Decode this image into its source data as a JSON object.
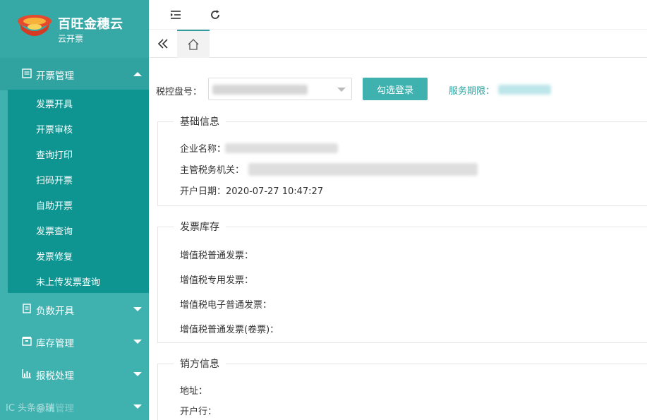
{
  "brand": {
    "title": "百旺金穗云",
    "subtitle": "云开票"
  },
  "sidebar": {
    "groups": [
      {
        "label": "开票管理",
        "icon": "invoice-icon",
        "expanded": true
      },
      {
        "label": "负数开具",
        "icon": "document-icon",
        "expanded": false
      },
      {
        "label": "库存管理",
        "icon": "inventory-icon",
        "expanded": false
      },
      {
        "label": "报税处理",
        "icon": "bar-chart-icon",
        "expanded": false
      },
      {
        "label": "系统管理",
        "icon": "settings-icon",
        "expanded": false
      }
    ],
    "submenu": [
      "发票开具",
      "开票审核",
      "查询打印",
      "扫码开票",
      "自助开票",
      "发票查询",
      "发票修复",
      "未上传发票查询"
    ],
    "watermark": "IC 头条@瑞"
  },
  "toolbar": {
    "menu_icon": "menu-fold-icon",
    "refresh_icon": "refresh-icon"
  },
  "tabs": {
    "collapse_icon": "double-chevron-left-icon",
    "home_icon": "home-icon"
  },
  "main": {
    "disk_label": "税控盘号：",
    "login_button": "勾选登录",
    "service_label": "服务期限：",
    "basic": {
      "legend": "基础信息",
      "company_label": "企业名称：",
      "tax_office_label": "主管税务机关：",
      "open_date_label": "开户日期：",
      "open_date_value": "2020-07-27 10:47:27"
    },
    "stock": {
      "legend": "发票库存",
      "rows": [
        "增值税普通发票：",
        "增值税专用发票：",
        "增值税电子普通发票：",
        "增值税普通发票(卷票)："
      ]
    },
    "seller": {
      "legend": "销方信息",
      "address_label": "地址：",
      "bank_label": "开户行："
    }
  },
  "colors": {
    "sidebar": "#3fb2b0",
    "submenu": "#0e9592",
    "accent": "#2aa4a2"
  }
}
